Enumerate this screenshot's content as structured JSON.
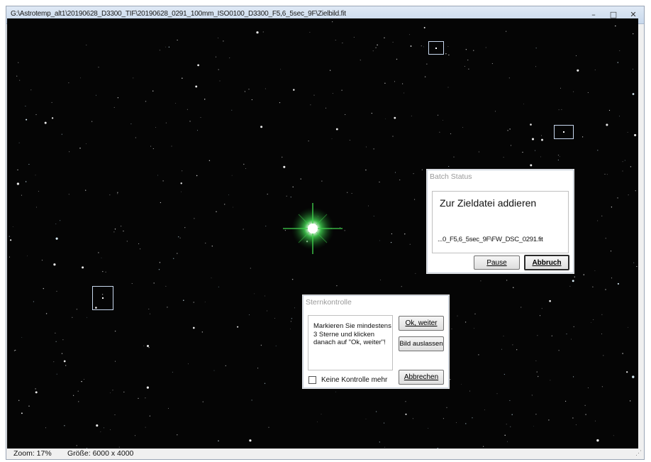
{
  "window": {
    "title": "G:\\Astrotemp_alt1\\20190628_D3300_TIF\\20190628_0291_100mm_ISO0100_D3300_F5,6_5sec_9F\\Zielbild.fit",
    "controls": {
      "minimize": "–",
      "maximize": "□",
      "close": "✕"
    }
  },
  "statusbar": {
    "zoom": "Zoom: 17%",
    "size": "Größe: 6000 x 4000"
  },
  "batch_status": {
    "title": "Batch Status",
    "heading": "Zur Zieldatei addieren",
    "file": "...0_F5,6_5sec_9F\\FW_DSC_0291.fit",
    "pause_label": "Pause",
    "abort_label": "Abbruch"
  },
  "sternkontrolle": {
    "title": "Sternkontrolle",
    "instructions": "Markieren Sie mindestens 3 Sterne und klicken danach auf \"Ok, weiter\"!",
    "ok_label": "Ok, weiter",
    "skip_label": "Bild auslassen",
    "cancel_label": "Abbrechen",
    "checkbox_label": "Keine Kontrolle mehr",
    "checkbox_checked": false
  },
  "colors": {
    "sky": "#050505",
    "star_glow": "#2fa03a",
    "dialog_border": "#c6cfdb"
  }
}
